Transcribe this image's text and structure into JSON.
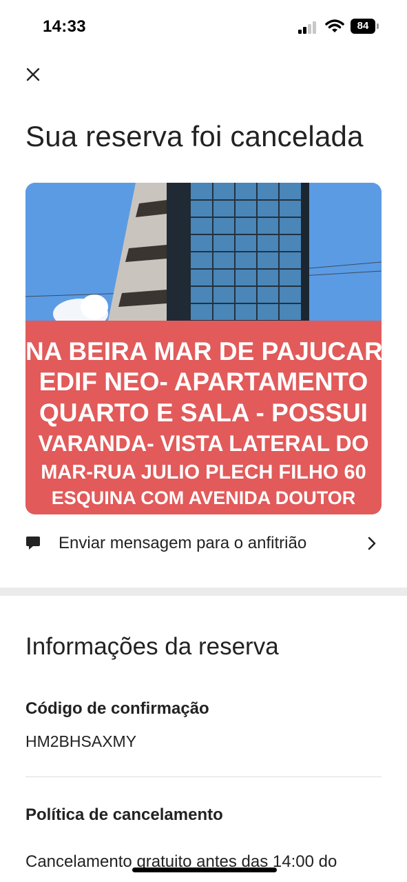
{
  "status_bar": {
    "time": "14:33",
    "battery": "84",
    "icons": [
      "cellular-signal-icon",
      "wifi-icon",
      "battery-icon"
    ]
  },
  "header": {
    "close_icon": "close-icon",
    "title": "Sua reserva foi cancelada"
  },
  "listing": {
    "image_text_lines": [
      "NA BEIRA MAR DE PAJUCARA-",
      "EDIF NEO- APARTAMENTO",
      "QUARTO E SALA - POSSUI",
      "VARANDA- VISTA LATERAL DO",
      "MAR-RUA JULIO PLECH FILHO 60",
      "ESQUINA COM AVENIDA DOUTOR"
    ]
  },
  "message_host": {
    "icon": "chat-bubble-icon",
    "label": "Enviar mensagem para o anfitrião",
    "chevron_icon": "chevron-right-icon"
  },
  "reservation_info": {
    "title": "Informações da reserva",
    "confirmation_label": "Código de confirmação",
    "confirmation_code": "HM2BHSAXMY",
    "cancellation_label": "Política de cancelamento",
    "cancellation_text_before": "Cancelamento",
    "cancellation_link": "gratuito antes",
    "cancellation_text_after": "das 14:00 do"
  },
  "colors": {
    "text": "#222222",
    "banner_red": "#e25a5a",
    "sky_blue": "#5a9be4",
    "divider": "#ebebeb"
  }
}
